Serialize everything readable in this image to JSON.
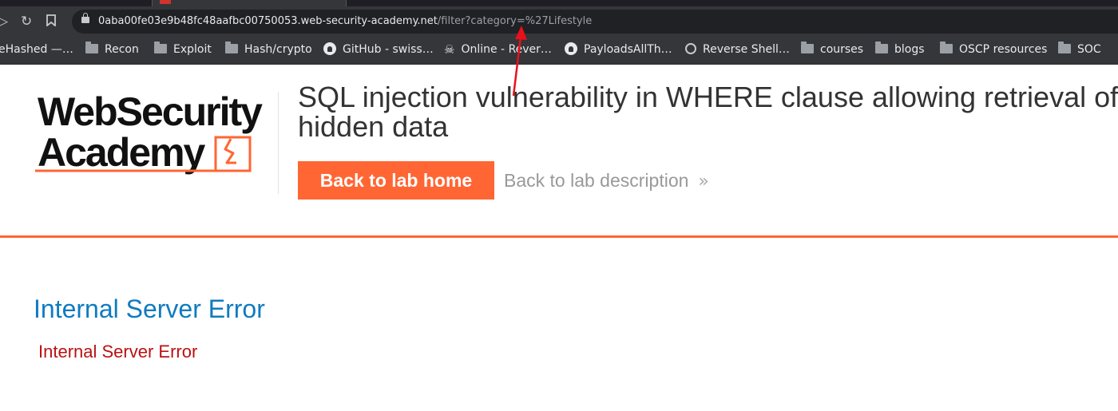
{
  "browser": {
    "url_host": "0aba00fe03e9b48fc48aafbc00750053.web-security-academy.net",
    "url_path": "/filter?category=%27Lifestyle",
    "bookmarks": [
      {
        "label": "eHashed —…",
        "icon": "none"
      },
      {
        "label": "Recon",
        "icon": "folder-icon"
      },
      {
        "label": "Exploit",
        "icon": "folder-icon"
      },
      {
        "label": "Hash/crypto",
        "icon": "folder-icon"
      },
      {
        "label": "GitHub - swiss…",
        "icon": "github-icon"
      },
      {
        "label": "Online - Rever…",
        "icon": "skull-icon"
      },
      {
        "label": "PayloadsAllTh…",
        "icon": "github-icon"
      },
      {
        "label": "Reverse Shell…",
        "icon": "globe-icon"
      },
      {
        "label": "courses",
        "icon": "folder-icon"
      },
      {
        "label": "blogs",
        "icon": "folder-icon"
      },
      {
        "label": "OSCP resources",
        "icon": "folder-icon"
      },
      {
        "label": "SOC",
        "icon": "folder-icon"
      }
    ]
  },
  "header": {
    "logo_line1": "WebSecurity",
    "logo_line2": "Academy",
    "title": "SQL injection vulnerability in WHERE clause allowing retrieval of hidden data",
    "back_home_label": "Back to lab home",
    "back_description_label": "Back to lab description"
  },
  "content": {
    "error_heading": "Internal Server Error",
    "error_text": "Internal Server Error"
  },
  "colors": {
    "accent": "#ff6633",
    "heading_blue": "#0f7bc0",
    "error_red": "#bb1111",
    "annotation_arrow": "#e8101a"
  }
}
